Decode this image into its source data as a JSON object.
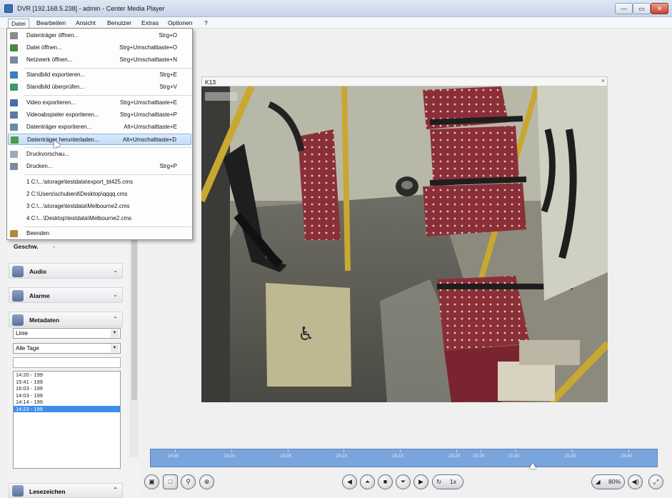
{
  "window": {
    "title": "DVR [192.168.5.238] - admin - Center Media Player",
    "min_label": "—",
    "max_label": "▭",
    "close_label": "✕"
  },
  "menubar": [
    "Datei",
    "Bearbeiten",
    "Ansicht",
    "Benutzer",
    "Extras",
    "Optionen",
    "?"
  ],
  "file_menu": {
    "items": [
      {
        "label": "Datenträger öffnen...",
        "shortcut": "Strg+O",
        "icon": "disk-icon"
      },
      {
        "label": "Datei öffnen...",
        "shortcut": "Strg+Umschalttaste+O",
        "icon": "file-icon"
      },
      {
        "label": "Netzwerk öffnen...",
        "shortcut": "Strg+Umschalttaste+N",
        "icon": "network-icon"
      },
      {
        "label": "Standbild exportieren...",
        "shortcut": "Strg+E",
        "icon": "image-export-icon"
      },
      {
        "label": "Standbild überprüfen...",
        "shortcut": "Strg+V",
        "icon": "image-verify-icon"
      },
      {
        "label": "Video exportieren...",
        "shortcut": "Strg+Umschalttaste+E",
        "icon": "video-export-icon"
      },
      {
        "label": "Videoabspieler exportieren...",
        "shortcut": "Strg+Umschalttaste+P",
        "icon": "player-export-icon"
      },
      {
        "label": "Datenträger exportieren...",
        "shortcut": "Alt+Umschalttaste+E",
        "icon": "disk-export-icon"
      },
      {
        "label": "Datenträger herunterladen...",
        "shortcut": "Alt+Umschalttaste+D",
        "icon": "download-icon"
      },
      {
        "label": "Druckvorschau...",
        "shortcut": "",
        "icon": "print-preview-icon"
      },
      {
        "label": "Drucken...",
        "shortcut": "Strg+P",
        "icon": "print-icon"
      },
      {
        "label": "1 C:\\...\\storage\\testdata\\export_bt425.cms",
        "shortcut": "",
        "icon": ""
      },
      {
        "label": "2 C:\\Users\\schuberd\\Desktop\\qqqq.cms",
        "shortcut": "",
        "icon": ""
      },
      {
        "label": "3 C:\\...\\storage\\testdata\\Melbourne2.cms",
        "shortcut": "",
        "icon": ""
      },
      {
        "label": "4 C:\\...\\Desktop\\testdata\\Melbourne2.cms",
        "shortcut": "",
        "icon": ""
      },
      {
        "label": "Beenden",
        "shortcut": "",
        "icon": "exit-icon"
      }
    ]
  },
  "left_panel": {
    "speed_label": "Geschw.",
    "speed_value": "-",
    "sections": {
      "audio": "Audio",
      "alarms": "Alarme",
      "metadata": "Metadaten",
      "bookmarks": "Lesezeichen"
    },
    "metadata_filter_1": "Linie",
    "metadata_filter_2": "Alle Tage",
    "events": [
      "14:20 - 199",
      "15:41 - 199",
      "16:03 - 199",
      "14:03 - 199",
      "14:14 - 199",
      "14:23 - 199"
    ],
    "selected_event_index": 5
  },
  "video": {
    "camera_label": "K13",
    "close_label": "×"
  },
  "timeline": {
    "ticks": [
      "14:55",
      "15:00",
      "15:05",
      "15:10",
      "15:15",
      "15:20",
      "15:25",
      "15:30",
      "15:35",
      "15:40"
    ]
  },
  "controls": {
    "speed": "1x",
    "volume": "80%"
  },
  "colors": {
    "timeline": "#7aa4dc",
    "selection": "#3d8ee8",
    "menu_highlight": "#c2dcf6"
  }
}
